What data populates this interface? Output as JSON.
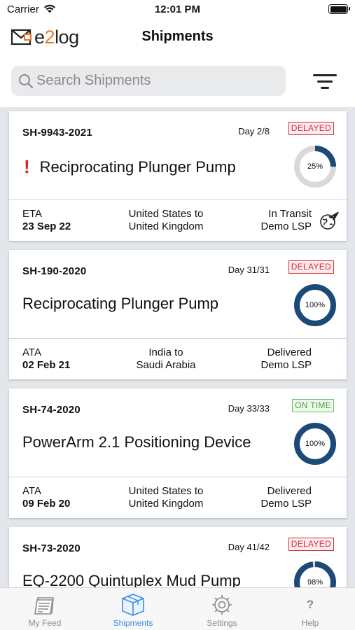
{
  "status_bar": {
    "carrier": "Carrier",
    "time": "12:01 PM"
  },
  "nav": {
    "title": "Shipments",
    "logo_prefix": "e",
    "logo_accent": "2",
    "logo_suffix": "log"
  },
  "search": {
    "placeholder": "Search Shipments",
    "value": ""
  },
  "shipments": [
    {
      "id": "SH-9943-2021",
      "day": "Day 2/8",
      "status_badge": "DELAYED",
      "alert": "!",
      "name": "Reciprocating Plunger Pump",
      "progress_label": "25%",
      "progress": 0.25,
      "date_label": "ETA",
      "date": "23 Sep 22",
      "route_line1": "United States to",
      "route_line2": "United Kingdom",
      "state": "In Transit",
      "provider": "Demo LSP",
      "transport_icon": "plane-globe-icon"
    },
    {
      "id": "SH-190-2020",
      "day": "Day 31/31",
      "status_badge": "DELAYED",
      "name": "Reciprocating Plunger Pump",
      "progress_label": "100%",
      "progress": 1.0,
      "date_label": "ATA",
      "date": "02 Feb 21",
      "route_line1": "India to",
      "route_line2": "Saudi Arabia",
      "state": "Delivered",
      "provider": "Demo LSP"
    },
    {
      "id": "SH-74-2020",
      "day": "Day 33/33",
      "status_badge": "ON TIME",
      "name": "PowerArm 2.1 Positioning Device",
      "progress_label": "100%",
      "progress": 1.0,
      "date_label": "ATA",
      "date": "09 Feb 20",
      "route_line1": "United States to",
      "route_line2": "United Kingdom",
      "state": "Delivered",
      "provider": "Demo LSP"
    },
    {
      "id": "SH-73-2020",
      "day": "Day 41/42",
      "status_badge": "DELAYED",
      "name": "EQ-2200 Quintuplex Mud Pump",
      "progress_label": "98%",
      "progress": 0.98
    }
  ],
  "tabs": [
    {
      "label": "My Feed",
      "icon": "feed-icon"
    },
    {
      "label": "Shipments",
      "icon": "box-icon",
      "active": true
    },
    {
      "label": "Settings",
      "icon": "gear-icon"
    },
    {
      "label": "Help",
      "icon": "help-icon",
      "glyph": "?"
    }
  ],
  "colors": {
    "accent": "#3a8ee6",
    "donut": "#1c4a78",
    "donut_track": "#d9d9d9",
    "delayed": "#d2303a",
    "ontime": "#3aa636",
    "list_bg": "#e3e6ea"
  }
}
